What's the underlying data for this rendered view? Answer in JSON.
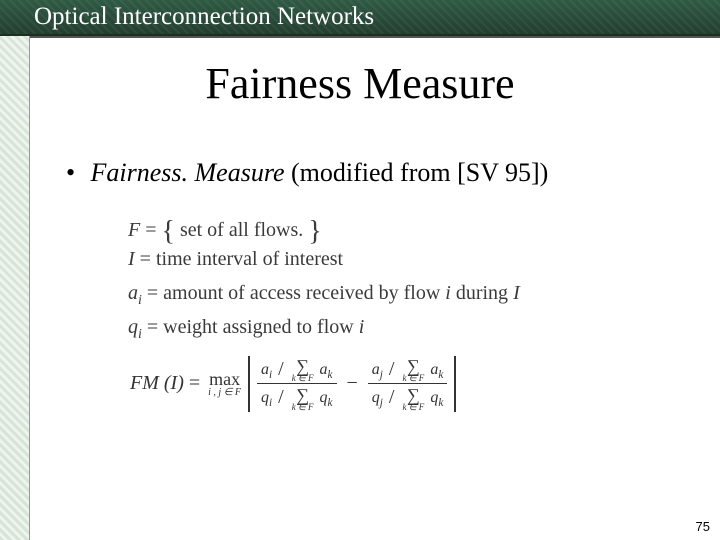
{
  "header": {
    "title": "Optical Interconnection Networks"
  },
  "slide": {
    "title": "Fairness Measure",
    "bullet": {
      "dot": "•",
      "term_italic": "Fairness. Measure",
      "rest": " (modified from [SV 95])"
    }
  },
  "defs": {
    "F": {
      "lhs": "F",
      "eq": "=",
      "rhs": "set of all flows."
    },
    "I": {
      "lhs": "I",
      "eq": "=",
      "rhs": "time interval of interest"
    },
    "a": {
      "lhs": "a",
      "sub": "i",
      "eq": "=",
      "rhs_a": "amount of access received by flow ",
      "rhs_i": "i",
      "rhs_b": " during ",
      "rhs_I": "I"
    },
    "q": {
      "lhs": "q",
      "sub": "i",
      "eq": "=",
      "rhs_a": "weight assigned to flow ",
      "rhs_i": "i"
    }
  },
  "formula": {
    "lhs": "FM (I)",
    "eq": "=",
    "max": "max",
    "max_cond": "i , j ∈ F",
    "sum_cond": "k ∈ F",
    "sigma": "∑",
    "a": "a",
    "q": "q",
    "i": "i",
    "j": "j",
    "k": "k",
    "slash": "/",
    "minus": "−"
  },
  "page": {
    "number": "75"
  }
}
